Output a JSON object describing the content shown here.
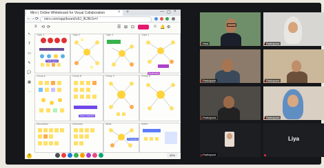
{
  "browser": {
    "tab_title": "Miro | Online Whiteboard for Visual Collaboration",
    "url": "miro.com/app/board/o9J_lKJ8r2o=/",
    "new_tab": "+",
    "tab_close": "×",
    "window_controls": [
      "—",
      "▢",
      "×"
    ]
  },
  "board": {
    "share_label": "Share",
    "help_label": "?",
    "zoom_label": "40%",
    "left_tools": [
      "↖",
      "T",
      "▭",
      "✎",
      "💬",
      "▦",
      "⋯"
    ],
    "top_tools": [
      "≡",
      "⟲",
      "⟳",
      "☰",
      "⊞",
      "⊡",
      "☺",
      "🔔",
      "⚙"
    ],
    "frames": [
      {
        "title": "Topic 1"
      },
      {
        "title": "Topic 2"
      },
      {
        "title": "Topic 3"
      },
      {
        "title": "Topic 4"
      },
      {
        "title": "Group A"
      },
      {
        "title": "Group B"
      },
      {
        "title": "Group C"
      },
      {
        "title": "Group D"
      },
      {
        "title": "Discussion"
      },
      {
        "title": "Summary"
      },
      {
        "title": "Ideas"
      },
      {
        "title": "Notes"
      }
    ],
    "cursor_labels": [
      "Participant",
      "Moderator",
      "Team member",
      "Presenter"
    ],
    "accent": "#e6186c"
  },
  "gallery": {
    "tiles": [
      {
        "name": "Host",
        "muted": true
      },
      {
        "name": "Participant",
        "muted": true
      },
      {
        "name": "Participant",
        "muted": true
      },
      {
        "name": "Participant",
        "muted": true
      },
      {
        "name": "Participant",
        "muted": true
      },
      {
        "name": "Participant",
        "muted": true
      },
      {
        "name": "Participant",
        "muted": true
      },
      {
        "name": "Participant",
        "muted": true
      },
      {
        "name": "Participant",
        "muted": true
      },
      {
        "name": "Liya",
        "muted": true,
        "avatar_text": "Liya"
      }
    ]
  }
}
